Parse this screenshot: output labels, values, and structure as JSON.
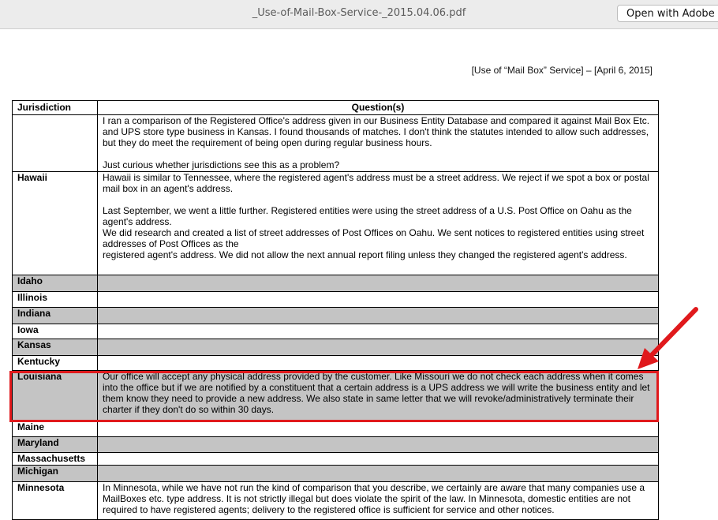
{
  "window": {
    "filename": "_Use-of-Mail-Box-Service-_2015.04.06.pdf",
    "open_button": "Open with Adobe A"
  },
  "document": {
    "header_ref": "[Use of “Mail Box” Service]  – [April 6, 2015]",
    "table": {
      "columns": [
        "Jurisdiction",
        "Question(s)"
      ],
      "rows": [
        {
          "jurisdiction": "",
          "shaded": false,
          "answer": [
            "I ran a comparison of the Registered Office's address given in our Business Entity Database and compared it against Mail Box Etc. and  UPS store type business in Kansas. I found thousands of matches. I don't think the statutes intended to allow such addresses, but they do meet the requirement of being open during regular business hours.",
            "",
            "Just curious whether jurisdictions see this as a problem?"
          ]
        },
        {
          "jurisdiction": "Hawaii",
          "shaded": false,
          "answer": [
            "Hawaii is similar to Tennessee, where the registered agent's address must be a street address.  We reject if we spot a box or postal mail box in an agent's address.",
            "",
            "Last September, we went a little further.   Registered entities were using the street address of a U.S. Post Office on Oahu as the agent's address.",
            "We did research and created a list of street addresses of Post Offices on Oahu.   We sent notices to registered entities using street addresses of Post Offices as the",
            "registered agent's address.  We did not allow the next annual report filing unless they changed the registered agent's address."
          ]
        },
        {
          "jurisdiction": "Idaho",
          "shaded": true,
          "answer": []
        },
        {
          "jurisdiction": "Illinois",
          "shaded": false,
          "answer": []
        },
        {
          "jurisdiction": "Indiana",
          "shaded": true,
          "answer": []
        },
        {
          "jurisdiction": "Iowa",
          "shaded": false,
          "answer": []
        },
        {
          "jurisdiction": "Kansas",
          "shaded": true,
          "answer": []
        },
        {
          "jurisdiction": "Kentucky",
          "shaded": false,
          "answer": []
        },
        {
          "jurisdiction": "Louisiana",
          "shaded": true,
          "answer": [
            "Our office will accept any physical address provided by the customer. Like Missouri we do not check each address when it comes into the office but if we are notified by a constituent that a certain address is a UPS address we will write the business entity and let them know they need to provide a new address. We also state in same letter that we will revoke/administratively terminate their charter if they don't do so within 30 days."
          ]
        },
        {
          "jurisdiction": "Maine",
          "shaded": false,
          "answer": []
        },
        {
          "jurisdiction": "Maryland",
          "shaded": true,
          "answer": []
        },
        {
          "jurisdiction": "Massachusetts",
          "shaded": false,
          "answer": []
        },
        {
          "jurisdiction": "Michigan",
          "shaded": true,
          "answer": []
        },
        {
          "jurisdiction": "Minnesota",
          "shaded": false,
          "answer": [
            "In Minnesota, while we have not run the kind of comparison that you describe, we certainly are aware that many companies use a MailBoxes etc. type address. It is not strictly illegal but does violate the spirit of the law. In Minnesota, domestic entities are not required to have registered agents; delivery to the registered office is sufficient for service and other notices."
          ]
        }
      ]
    }
  },
  "annotation": {
    "highlight_color": "#e0191c",
    "arrow_color": "#e0191c"
  }
}
